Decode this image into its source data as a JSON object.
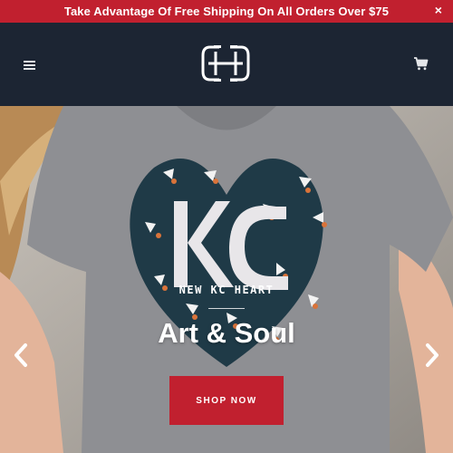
{
  "announcement": {
    "text": "Take Advantage Of Free Shipping On All Orders Over $75",
    "close_label": "×"
  },
  "header": {
    "logo_icon": "kc-monogram-logo",
    "menu_icon": "hamburger-menu-icon",
    "cart_icon": "cart-icon"
  },
  "hero": {
    "subtitle": "NEW KC HEART",
    "title": "Art & Soul",
    "cta_label": "SHOP NOW",
    "shirt_text": "KC",
    "prev_icon": "chevron-left-icon",
    "next_icon": "chevron-right-icon"
  },
  "colors": {
    "brand_red": "#c1202f",
    "header_navy": "#1c2533",
    "heart_navy": "#1f3a47"
  }
}
